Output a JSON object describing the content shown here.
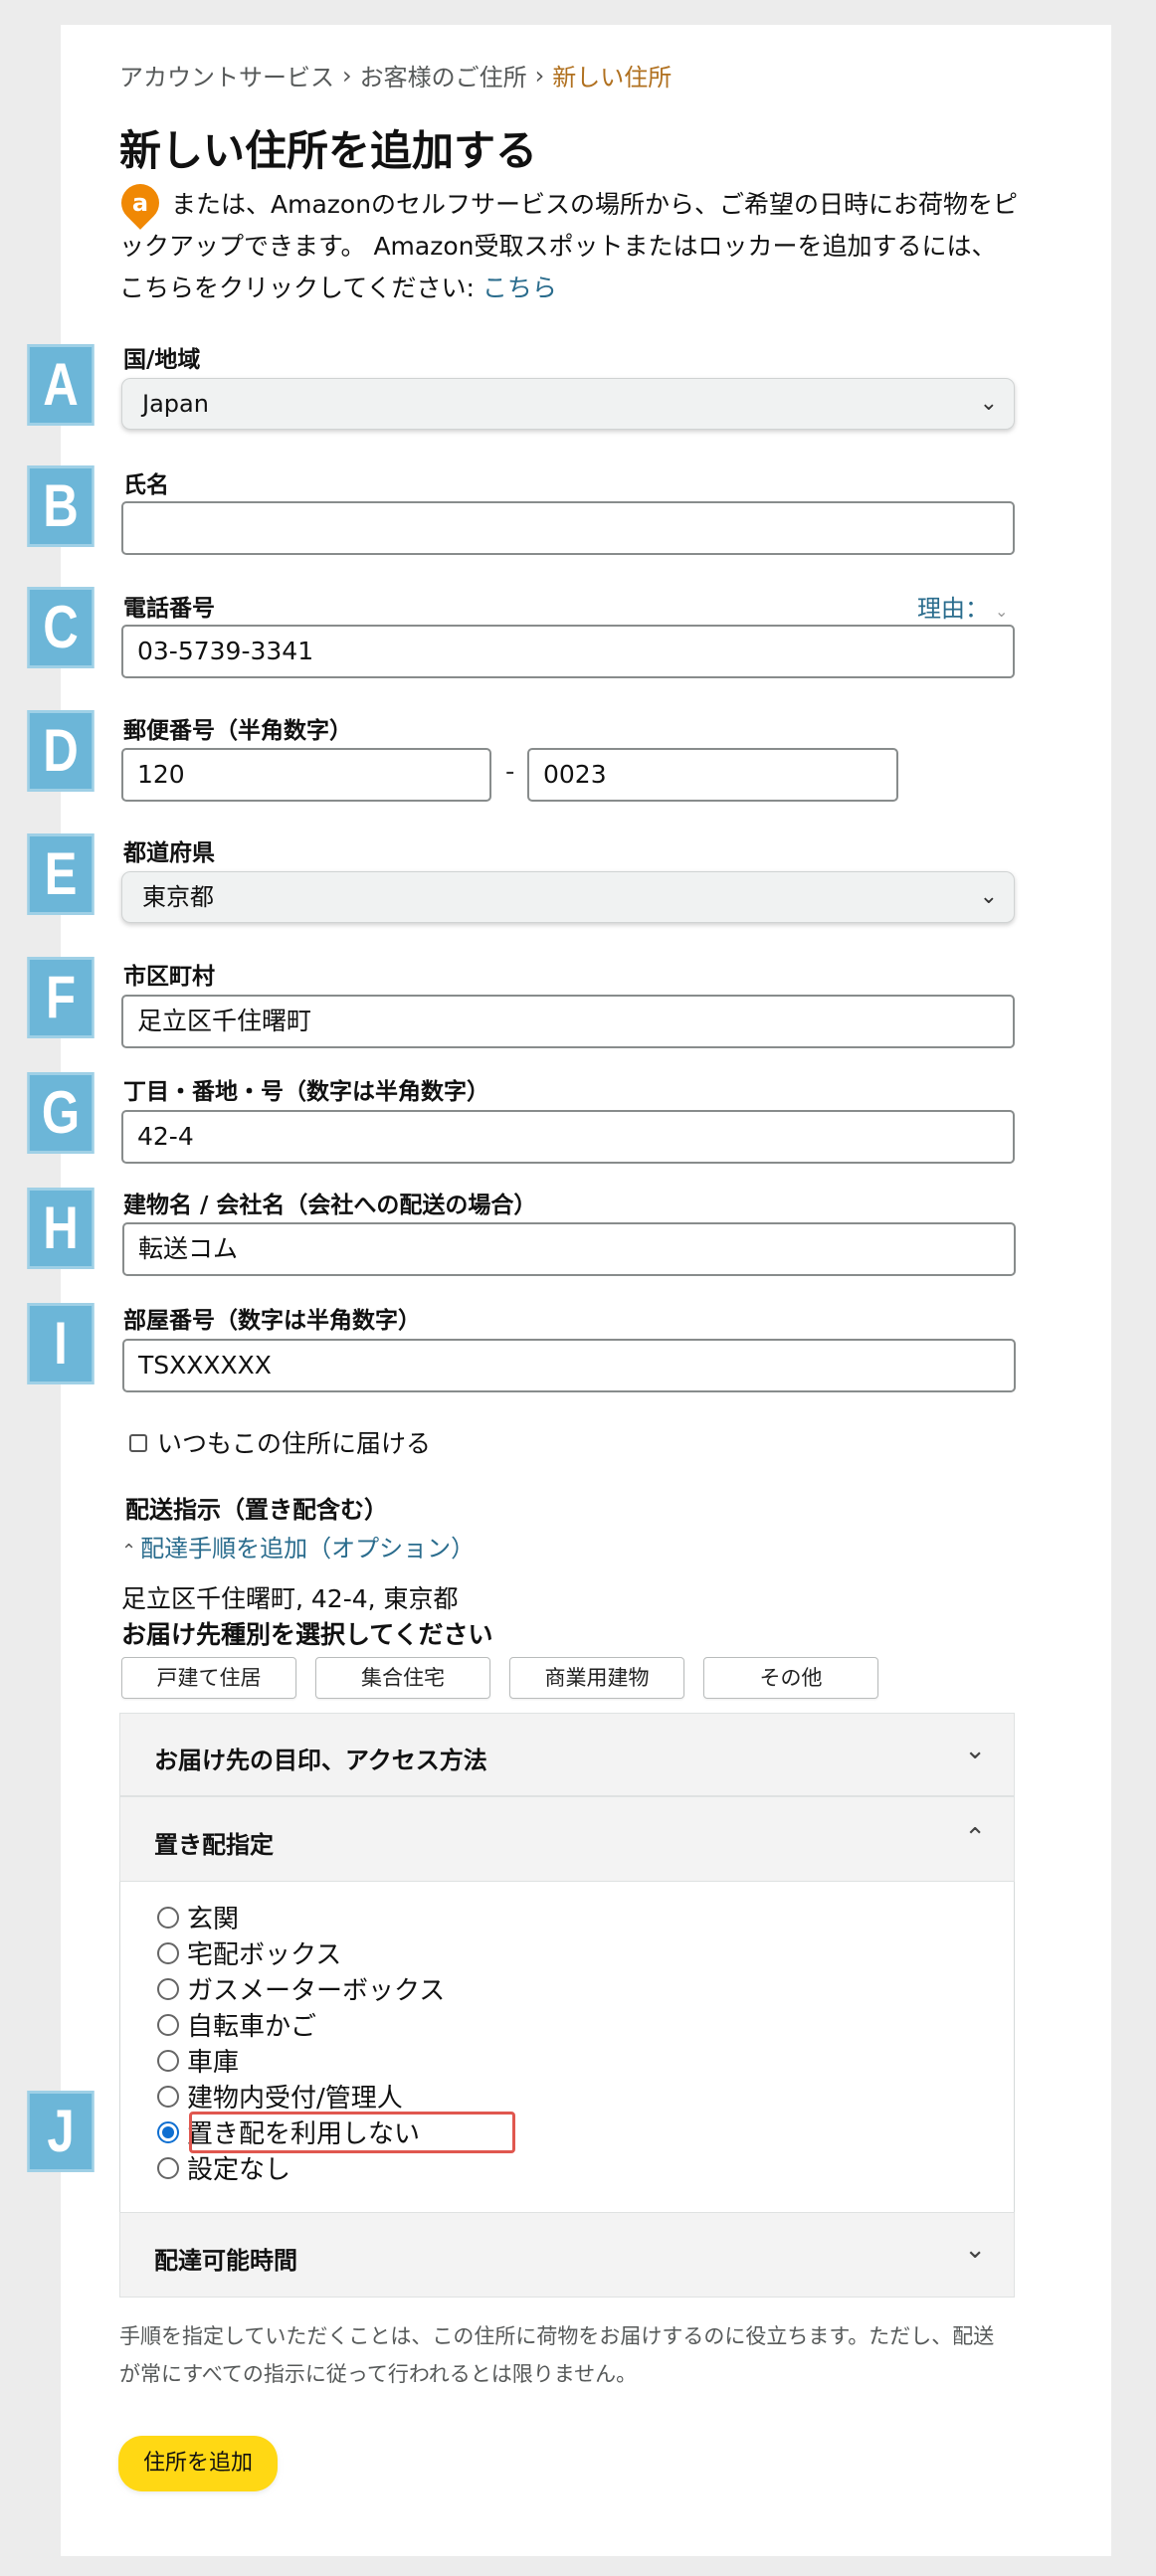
{
  "breadcrumb": {
    "item1": "アカウントサービス",
    "sep": "›",
    "item2": "お客様のご住所",
    "current": "新しい住所"
  },
  "page_title": "新しい住所を追加する",
  "intro": {
    "badge": "a",
    "text": "または、Amazonのセルフサービスの場所から、ご希望の日時にお荷物をピックアップできます。 Amazon受取スポットまたはロッカーを追加するには、こちらをクリックしてください: ",
    "link": "こちら"
  },
  "markers": {
    "a": "A",
    "b": "B",
    "c": "C",
    "d": "D",
    "e": "E",
    "f": "F",
    "g": "G",
    "h": "H",
    "i": "I",
    "j": "J"
  },
  "form": {
    "country": {
      "label": "国/地域",
      "value": "Japan"
    },
    "name": {
      "label": "氏名",
      "value": ""
    },
    "phone": {
      "label": "電話番号",
      "value": "03-5739-3341",
      "reason": "理由："
    },
    "postal": {
      "label": "郵便番号（半角数字）",
      "part1": "120",
      "sep": "-",
      "part2": "0023"
    },
    "prefecture": {
      "label": "都道府県",
      "value": "東京都"
    },
    "city": {
      "label": "市区町村",
      "value": "足立区千住曙町"
    },
    "street": {
      "label": "丁目・番地・号（数字は半角数字）",
      "value": "42-4"
    },
    "building": {
      "label": "建物名 / 会社名（会社への配送の場合）",
      "value": "転送コム"
    },
    "room": {
      "label": "部屋番号（数字は半角数字）",
      "value": "TSXXXXXX"
    },
    "default_checkbox": {
      "label": "いつもこの住所に届ける",
      "checked": false
    }
  },
  "delivery": {
    "title": "配送指示（置き配含む）",
    "toggle": "配達手順を追加（オプション）",
    "address": "足立区千住曙町, 42-4, 東京都",
    "choose_type": "お届け先種別を選択してください",
    "types": [
      "戸建て住居",
      "集合住宅",
      "商業用建物",
      "その他"
    ],
    "sections": {
      "access": "お届け先の目印、アクセス方法",
      "dropoff": "置き配指定",
      "hours": "配達可能時間"
    },
    "dropoff_options": [
      "玄関",
      "宅配ボックス",
      "ガスメーターボックス",
      "自転車かご",
      "車庫",
      "建物内受付/管理人",
      "置き配を利用しない",
      "設定なし"
    ],
    "selected_option": "置き配を利用しない"
  },
  "footnote": "手順を指定していただくことは、この住所に荷物をお届けするのに役立ちます。ただし、配送が常にすべての指示に従って行われるとは限りません。",
  "submit_label": "住所を追加",
  "colors": {
    "accent_link": "#2a6c8d",
    "marker_bg": "#6cb6d8",
    "submit_bg": "#ffd814",
    "highlight": "#e0574f",
    "radio_on": "#0f6fd1"
  },
  "icons": {
    "select_chevron": "chevron-down-icon",
    "acc_open": "chevron-up-icon",
    "acc_closed": "chevron-down-icon"
  }
}
